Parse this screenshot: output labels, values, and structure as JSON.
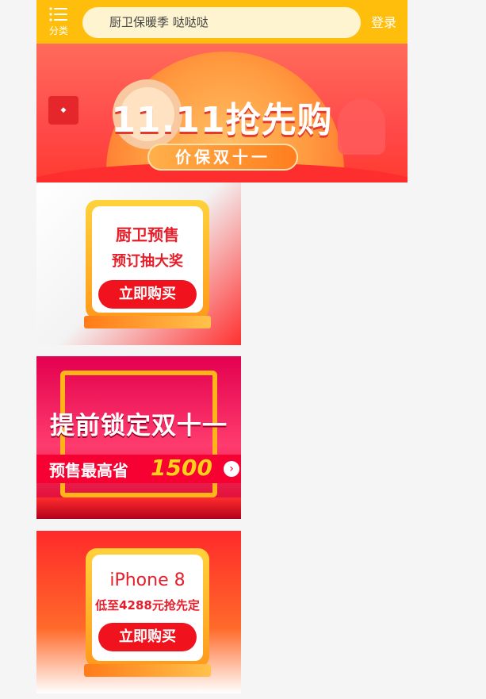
{
  "header": {
    "menu_label": "分类",
    "search_placeholder": "厨卫保暖季 哒哒哒",
    "login_label": "登录"
  },
  "hero": {
    "title": "11.11抢先购",
    "subtitle": "价保双十一"
  },
  "promos": [
    {
      "line1": "厨卫预售",
      "line2": "预订抽大奖",
      "button": "立即购买"
    },
    {
      "title": "提前锁定双十一",
      "banner_label": "预售最高省",
      "banner_number": "1500",
      "arrow": "›"
    },
    {
      "line1": "iPhone 8",
      "line2": "低至4288元抢先定",
      "button": "立即购买"
    }
  ],
  "colors": {
    "header_bg": "#ffbe0b",
    "accent_red": "#e51e2b"
  }
}
